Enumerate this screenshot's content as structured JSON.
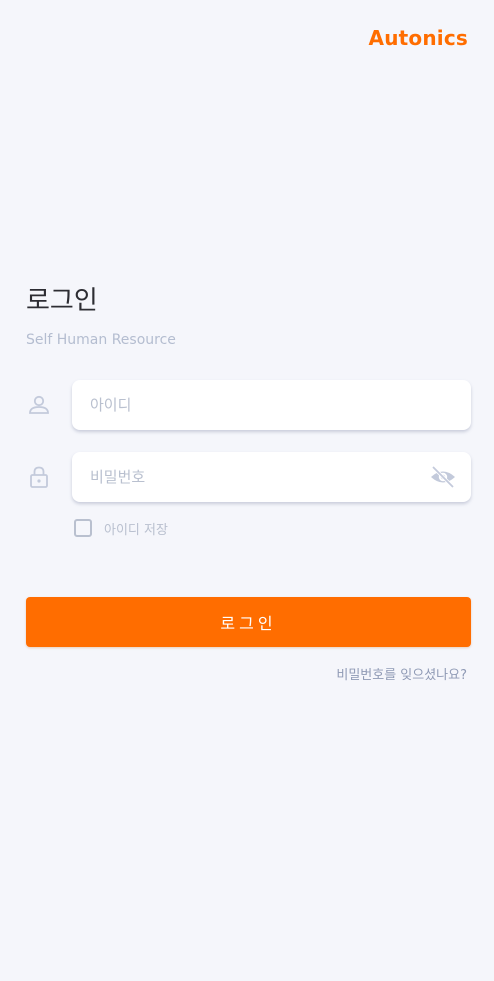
{
  "brand": {
    "logo_text": "Autonics",
    "accent_color": "#ff6d00"
  },
  "login": {
    "title": "로그인",
    "subtitle": "Self Human Resource",
    "id_field": {
      "icon": "user-icon",
      "placeholder": "아이디",
      "value": ""
    },
    "password_field": {
      "icon": "lock-icon",
      "placeholder": "비밀번호",
      "value": "",
      "toggle_icon": "eye-off-icon"
    },
    "remember_id": {
      "label": "아이디 저장",
      "checked": false
    },
    "submit_label": "로그인",
    "forgot_password_label": "비밀번호를 잊으셨나요?"
  }
}
